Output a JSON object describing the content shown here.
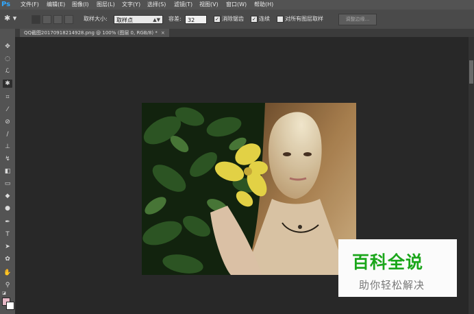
{
  "app": {
    "logo": "Ps"
  },
  "menu": [
    "文件(F)",
    "编辑(E)",
    "图像(I)",
    "图层(L)",
    "文字(Y)",
    "选择(S)",
    "滤镜(T)",
    "视图(V)",
    "窗口(W)",
    "帮助(H)"
  ],
  "options": {
    "tool_icon": "magic-wand-icon",
    "sample_size_label": "取样大小:",
    "sample_size_value": "取样点",
    "tolerance_label": "容差:",
    "tolerance_value": "32",
    "antialias_label": "消除锯齿",
    "contiguous_label": "连续",
    "all_layers_label": "对所有图层取样",
    "refine_edge_label": "调整边缘...",
    "check_mark": "✓"
  },
  "document_tab": {
    "title": "QQ截图20170918214928.png @ 100% (图层 0, RGB/8) *",
    "close": "×"
  },
  "watermark": {
    "main": "百科全说",
    "sub": "助你轻松解决"
  },
  "colors": {
    "foreground": "#e6b8c6",
    "background": "#ffffff",
    "accent": "#31a8ff",
    "watermark_green": "#1aa61a"
  }
}
